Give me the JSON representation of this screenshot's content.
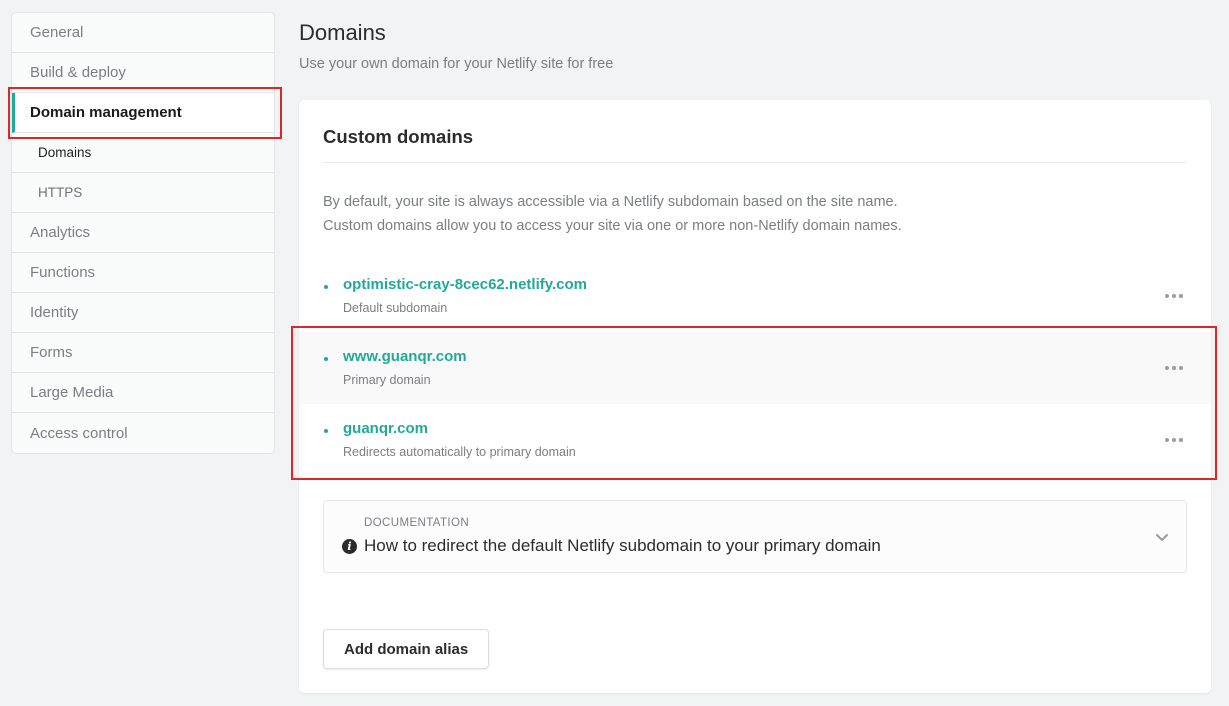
{
  "sidebar": {
    "items": [
      {
        "label": "General"
      },
      {
        "label": "Build & deploy"
      },
      {
        "label": "Domain management"
      },
      {
        "label": "Domains"
      },
      {
        "label": "HTTPS"
      },
      {
        "label": "Analytics"
      },
      {
        "label": "Functions"
      },
      {
        "label": "Identity"
      },
      {
        "label": "Forms"
      },
      {
        "label": "Large Media"
      },
      {
        "label": "Access control"
      }
    ]
  },
  "header": {
    "title": "Domains",
    "subtitle": "Use your own domain for your Netlify site for free"
  },
  "custom_domains": {
    "title": "Custom domains",
    "description_line1": "By default, your site is always accessible via a Netlify subdomain based on the site name.",
    "description_line2": "Custom domains allow you to access your site via one or more non-Netlify domain names.",
    "domains": [
      {
        "name": "optimistic-cray-8cec62.netlify.com",
        "note": "Default subdomain"
      },
      {
        "name": "www.guanqr.com",
        "note": "Primary domain"
      },
      {
        "name": "guanqr.com",
        "note": "Redirects automatically to primary domain"
      }
    ],
    "documentation": {
      "label": "DOCUMENTATION",
      "title": "How to redirect the default Netlify subdomain to your primary domain"
    },
    "add_button": "Add domain alias"
  },
  "colors": {
    "accent": "#23a899",
    "highlight": "#d42a2a"
  }
}
